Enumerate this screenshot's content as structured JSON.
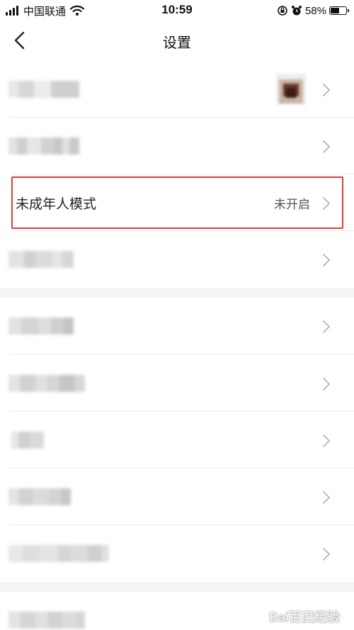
{
  "status_bar": {
    "carrier": "中国联通",
    "time": "10:59",
    "battery": "58%",
    "battery_level": 0.58
  },
  "nav": {
    "title": "设置",
    "back_icon": "chevron-left-icon"
  },
  "settings": {
    "minor_mode": {
      "label": "未成年人模式",
      "value": "未开启"
    }
  },
  "watermark": "Bai百度经验",
  "colors": {
    "highlight_border": "#e03a3a",
    "section_gap": "#f4f4f4",
    "chevron": "#b5b5b5"
  }
}
